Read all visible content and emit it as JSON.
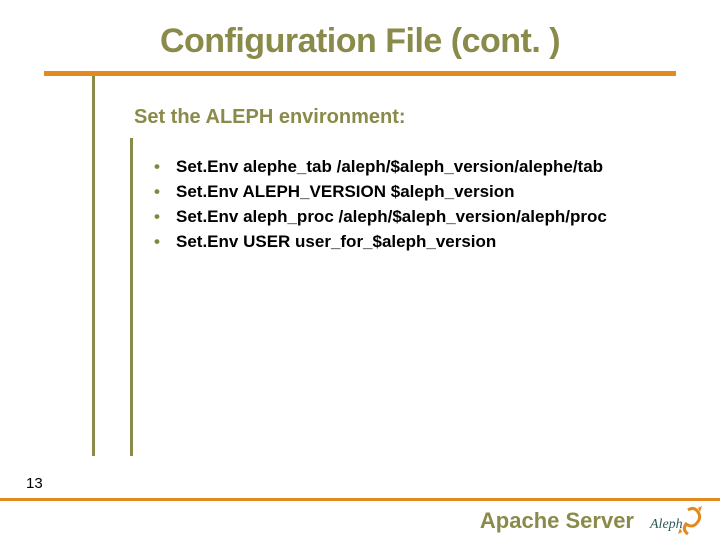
{
  "title": "Configuration File (cont. )",
  "subtitle": "Set the ALEPH environment:",
  "bullets": [
    "Set.Env alephe_tab /aleph/$aleph_version/alephe/tab",
    "Set.Env ALEPH_VERSION $aleph_version",
    "Set.Env aleph_proc /aleph/$aleph_version/aleph/proc",
    "Set.Env USER user_for_$aleph_version"
  ],
  "slide_number": "13",
  "footer_title": "Apache Server",
  "logo_text": "Aleph"
}
